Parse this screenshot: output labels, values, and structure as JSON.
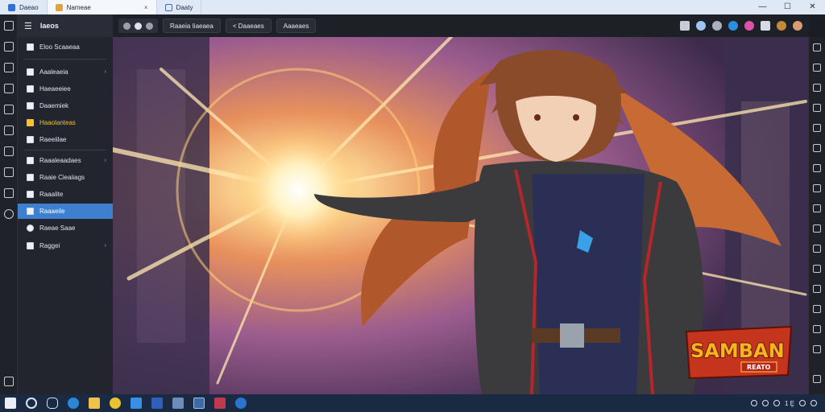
{
  "window": {
    "tabs": [
      {
        "label": "Daeao",
        "active": false
      },
      {
        "label": "Nameae",
        "active": true,
        "close": "×"
      },
      {
        "label": "Daaty",
        "active": false
      }
    ],
    "controls": {
      "minimize": "—",
      "maximize": "☐",
      "close": "✕"
    }
  },
  "sidebar": {
    "title": "Iaeos",
    "menu_icon": "hamburger-icon",
    "items": [
      {
        "label": "Eloo Scaaeaa",
        "arrow": ""
      },
      {
        "label": "Aaaleaeia",
        "arrow": "›"
      },
      {
        "label": "Haeaeeiee",
        "arrow": ""
      },
      {
        "label": "Daaemiek",
        "arrow": ""
      },
      {
        "label": "Haaolanteas",
        "arrow": "",
        "state": "highlighted"
      },
      {
        "label": "Raeeiilae",
        "arrow": ""
      },
      {
        "label": "Raaaleaadaes",
        "arrow": "›"
      },
      {
        "label": "Raaie Cieaiiags",
        "arrow": ""
      },
      {
        "label": "Raaalite",
        "arrow": ""
      },
      {
        "label": "Raaaeile",
        "arrow": "",
        "state": "selected"
      },
      {
        "label": "Raeae Saae",
        "arrow": ""
      },
      {
        "label": "Raggei",
        "arrow": "›"
      }
    ]
  },
  "toolbar": {
    "buttons": [
      "Raaeia Iiaeaea",
      "< Daaeaes",
      "Aaaeaes"
    ],
    "right_icons": [
      "bookmark-icon",
      "extension-icon",
      "info-icon",
      "globe-icon",
      "share-icon",
      "display-icon",
      "gift-icon",
      "avatar"
    ]
  },
  "artwork": {
    "logo_title": "SAMBAN",
    "logo_sub": "REATO",
    "colors": {
      "glow": "#fff4d6",
      "hair": "#8a4b2a",
      "coat": "#3b3a3c",
      "trim": "#b5262a",
      "shirt": "#2c2f55",
      "sky": "#c58ab6"
    }
  },
  "taskbar": {
    "tray_text": "1 Ḛ",
    "apps": [
      "start-icon",
      "search-icon",
      "chat-icon",
      "edge-icon",
      "folder-icon",
      "chrome-icon",
      "store-icon",
      "word-icon",
      "app-icon",
      "terminal-icon",
      "media-icon",
      "security-icon"
    ]
  }
}
